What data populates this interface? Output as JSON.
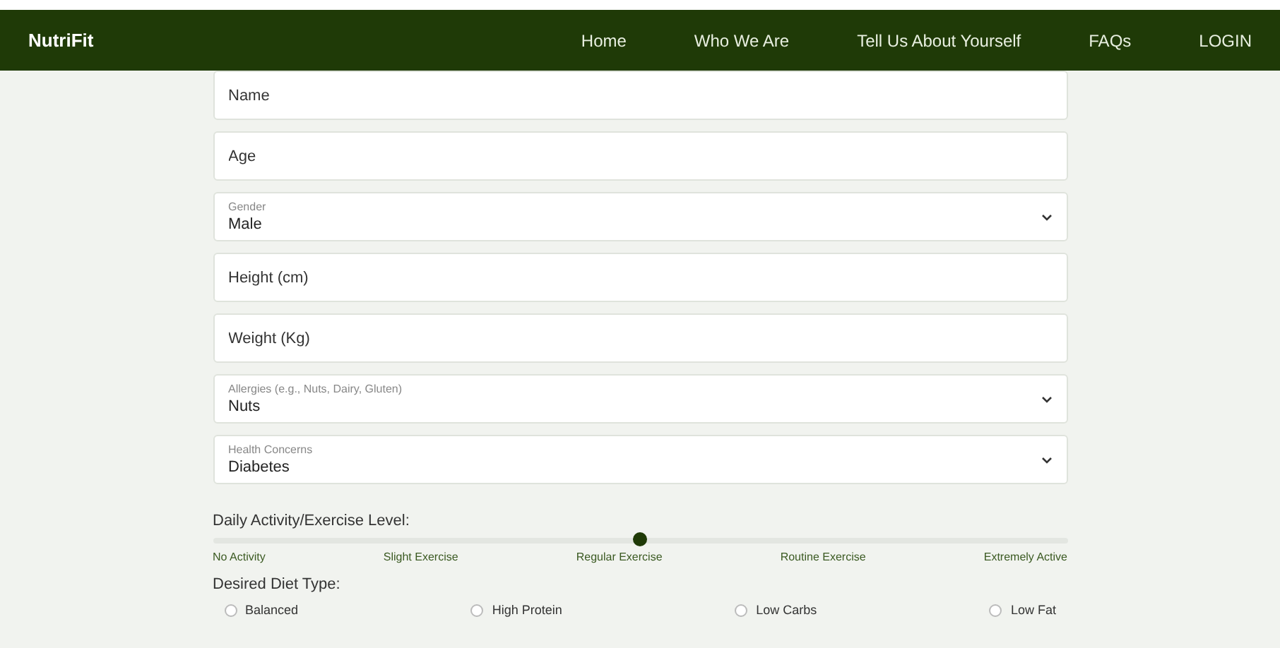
{
  "navbar": {
    "brand": "NutriFit",
    "links": [
      {
        "label": "Home"
      },
      {
        "label": "Who We Are"
      },
      {
        "label": "Tell Us About Yourself"
      },
      {
        "label": "FAQs"
      },
      {
        "label": "LOGIN"
      }
    ]
  },
  "form": {
    "fields": [
      {
        "kind": "text",
        "placeholder": "Name"
      },
      {
        "kind": "text",
        "placeholder": "Age"
      },
      {
        "kind": "select",
        "label": "Gender",
        "value": "Male"
      },
      {
        "kind": "text",
        "placeholder": "Height (cm)"
      },
      {
        "kind": "text",
        "placeholder": "Weight (Kg)"
      },
      {
        "kind": "select",
        "label": "Allergies (e.g., Nuts, Dairy, Gluten)",
        "value": "Nuts"
      },
      {
        "kind": "select",
        "label": "Health Concerns",
        "value": "Diabetes"
      }
    ],
    "activity": {
      "label": "Daily Activity/Exercise Level:",
      "level": 0.5,
      "stops": [
        "No Activity",
        "Slight Exercise",
        "Regular Exercise",
        "Routine Exercise",
        "Extremely Active"
      ]
    },
    "diet": {
      "label": "Desired Diet Type:",
      "options": [
        {
          "label": "Balanced",
          "selected": false
        },
        {
          "label": "High Protein",
          "selected": false
        },
        {
          "label": "Low Carbs",
          "selected": false
        },
        {
          "label": "Low Fat",
          "selected": false
        }
      ]
    }
  }
}
